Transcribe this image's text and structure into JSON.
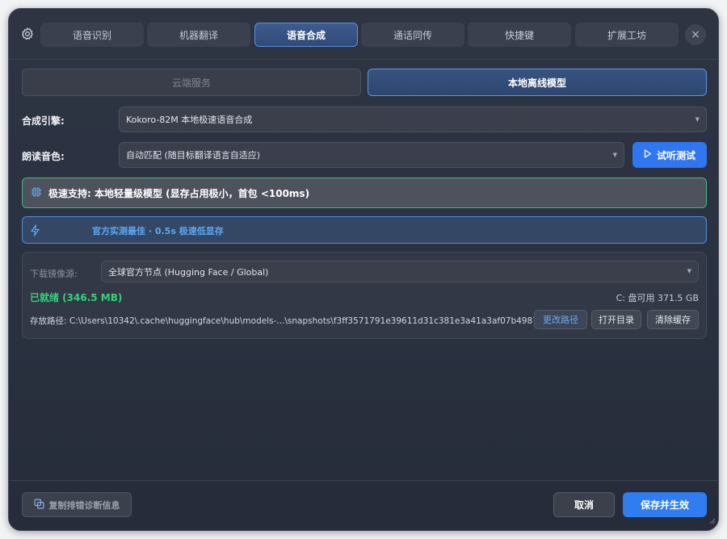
{
  "tabs": [
    {
      "label": "语音识别"
    },
    {
      "label": "机器翻译"
    },
    {
      "label": "语音合成"
    },
    {
      "label": "通话同传"
    },
    {
      "label": "快捷键"
    },
    {
      "label": "扩展工坊"
    }
  ],
  "active_tab": "语音合成",
  "close_label": "×",
  "mode": {
    "cloud": "云端服务",
    "local": "本地离线模型",
    "selected": "本地离线模型"
  },
  "engine": {
    "label": "合成引擎:",
    "value": "Kokoro-82M 本地极速语音合成"
  },
  "voice": {
    "label": "朗读音色:",
    "value": "自动匹配 (随目标翻译语言自适应)",
    "test_button": "试听测试"
  },
  "notice_green": "极速支持: 本地轻量级模型 (显存占用极小，首包 <100ms)",
  "notice_blue": "官方实测最佳 · 0.5s 极速低显存",
  "download": {
    "mirror_label": "下载镜像源:",
    "mirror_value": "全球官方节点 (Hugging Face / Global)",
    "status": "已就绪 (346.5 MB)",
    "disk": "C: 盘可用 371.5 GB",
    "path": "存放路径: C:\\Users\\10342\\.cache\\huggingface\\hub\\models-...\\snapshots\\f3ff3571791e39611d31c381e3a41a3af07b4987",
    "change_path": "更改路径",
    "open_dir": "打开目录",
    "clear_cache": "清除缓存"
  },
  "footer": {
    "copy_diag": "复制排错诊断信息",
    "cancel": "取消",
    "save": "保存并生效"
  },
  "colors": {
    "accent": "#2f7df0",
    "success": "#33d27c",
    "notice_border_green": "#3ebd7c",
    "notice_text_blue": "#5aa8f5"
  }
}
